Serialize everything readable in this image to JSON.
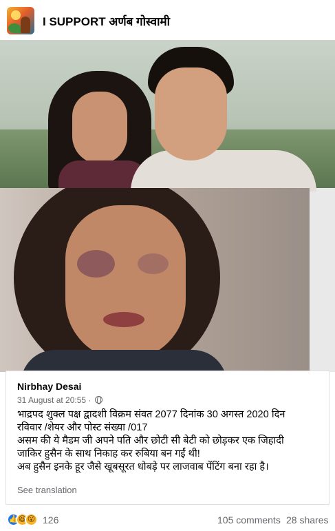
{
  "group": {
    "title": "I SUPPORT अर्णब गोस्वामी",
    "avatar_icon": "group-avatar-icon"
  },
  "post": {
    "author": "Nirbhay Desai",
    "timestamp": "31 August at 20:55 ·",
    "privacy_icon": "globe-icon",
    "text_lines": [
      "भाद्रपद शुक्ल पक्ष द्वादशी विक्रम संवत 2077 दिनांक 30 अगस्त 2020 दिन",
      "रविवार /शेयर और पोस्ट संख्या /017",
      "असम की ये मैडम जी अपने पति और छोटी सी बेटी को छोड़कर एक जिहादी",
      "जाकिर हुसैन के साथ निकाह कर रुबिया बन गईं थी!",
      "अब हुसैन इनके हूर जैसे खूबसूरत धोबड़े पर लाजवाब पेंटिंग बना रहा है।"
    ],
    "see_translation": "See translation"
  },
  "reactions": {
    "icons": [
      "like-icon",
      "haha-icon",
      "wow-icon"
    ],
    "count": "126",
    "comments": "105 comments",
    "shares": "28 shares"
  },
  "colors": {
    "like_blue": "#1877f2",
    "emoji_yellow": "#f7b125",
    "secondary_text": "#65676b"
  }
}
